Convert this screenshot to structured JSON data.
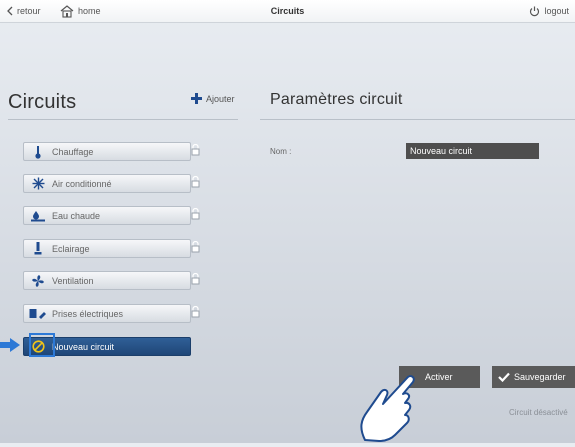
{
  "topbar": {
    "back_label": "retour",
    "home_label": "home",
    "title": "Circuits",
    "logout_label": "logout"
  },
  "left_panel": {
    "title": "Circuits",
    "add_label": "Ajouter",
    "items": [
      {
        "label": "Chauffage",
        "icon": "thermometer-icon"
      },
      {
        "label": "Air conditionné",
        "icon": "snowflake-icon"
      },
      {
        "label": "Eau chaude",
        "icon": "water-heater-icon"
      },
      {
        "label": "Eclairage",
        "icon": "lamp-icon"
      },
      {
        "label": "Ventilation",
        "icon": "fan-icon"
      },
      {
        "label": "Prises électriques",
        "icon": "plug-icon"
      },
      {
        "label": "Nouveau circuit",
        "icon": "prohibited-icon",
        "selected": true
      }
    ]
  },
  "right_panel": {
    "title": "Paramètres circuit",
    "name_label": "Nom :",
    "name_value": "Nouveau circuit",
    "activate_label": "Activer",
    "save_label": "Sauvegarder",
    "status_text": "Circuit désactivé"
  },
  "colors": {
    "accent": "#2a5a92",
    "highlight": "#2d79d6",
    "button_dark": "#5a5a5a"
  }
}
